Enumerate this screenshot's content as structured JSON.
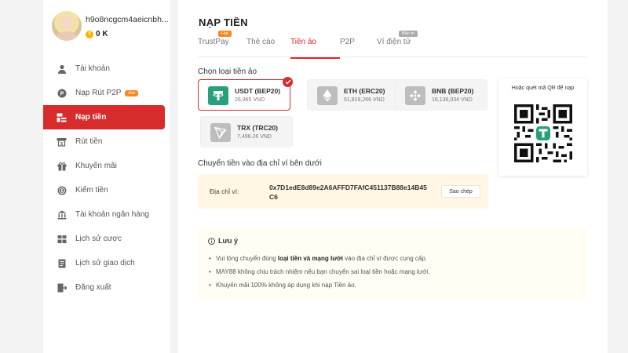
{
  "user": {
    "username": "h9o8ncgcm4aeicnbh...",
    "balance": "0 K"
  },
  "sidebar": {
    "items": [
      {
        "label": "Tài khoản",
        "icon": "user-icon"
      },
      {
        "label": "Nạp Rút P2P",
        "icon": "p2p-icon",
        "badge": "Hot"
      },
      {
        "label": "Nạp tiền",
        "icon": "deposit-icon",
        "active": true
      },
      {
        "label": "Rút tiền",
        "icon": "withdraw-icon"
      },
      {
        "label": "Khuyến mãi",
        "icon": "gift-icon"
      },
      {
        "label": "Kiếm tiền",
        "icon": "money-icon"
      },
      {
        "label": "Tài khoản ngân hàng",
        "icon": "bank-icon"
      },
      {
        "label": "Lịch sử cược",
        "icon": "bet-history-icon"
      },
      {
        "label": "Lịch sử giao dịch",
        "icon": "transaction-history-icon"
      },
      {
        "label": "Đăng xuất",
        "icon": "logout-icon"
      }
    ]
  },
  "page": {
    "title": "NẠP TIỀN"
  },
  "tabs": [
    {
      "label": "TrustPay",
      "badge": "Hot"
    },
    {
      "label": "Thẻ cào"
    },
    {
      "label": "Tiền ảo",
      "active": true
    },
    {
      "label": "P2P"
    },
    {
      "label": "Ví điện tử",
      "badge": "Bảo trì"
    }
  ],
  "crypto": {
    "section_label": "Chọn loại tiền ảo",
    "coins": [
      {
        "name": "USDT (BEP20)",
        "price": "26,965 VND",
        "selected": true,
        "color": "#26a17b"
      },
      {
        "name": "ETH (ERC20)",
        "price": "51,819,266 VND",
        "color": "#b8b8b8"
      },
      {
        "name": "BNB (BEP20)",
        "price": "16,136,034 VND",
        "color": "#b8b8b8"
      },
      {
        "name": "TRX (TRC20)",
        "price": "7,496.26 VND",
        "color": "#b8b8b8"
      }
    ]
  },
  "qr": {
    "label": "Hoặc quét mã QR để nạp"
  },
  "transfer": {
    "section_label": "Chuyển tiền vào địa chỉ ví bên dưới",
    "address_label": "Địa chỉ ví:",
    "address": "0x7D1edE8d89e2A6AFFD7FAfC451137B88e14B45C6",
    "copy_label": "Sao chép"
  },
  "note": {
    "title": "Lưu ý",
    "items": [
      {
        "before": "Vui lòng chuyển đúng ",
        "bold": "loại tiền và mạng lưới",
        "after": " vào địa chỉ ví được cung cấp."
      },
      {
        "before": "MAY88 không chịu trách nhiệm nếu bạn chuyển sai loại tiền hoặc mạng lưới.",
        "bold": "",
        "after": ""
      },
      {
        "before": "Khuyến mãi 100% không áp dụng khi nạp Tiền ảo.",
        "bold": "",
        "after": ""
      }
    ]
  },
  "colors": {
    "accent": "#d72c2c",
    "hot": "#f58a25",
    "usdt": "#26a17b"
  }
}
